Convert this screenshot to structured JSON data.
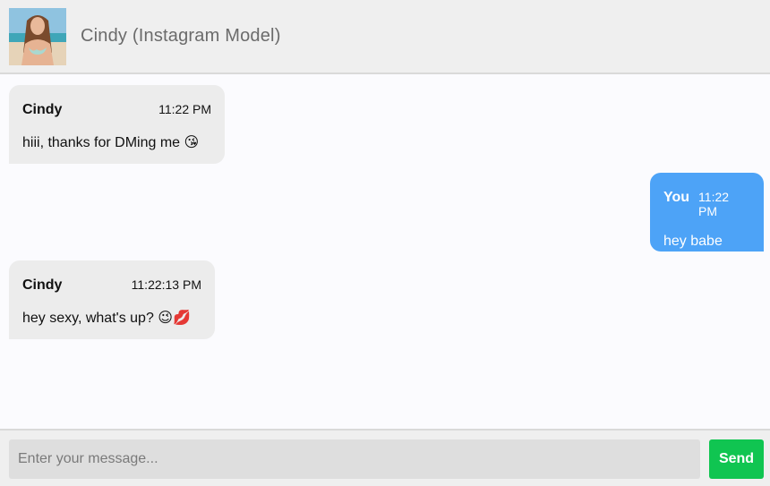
{
  "header": {
    "avatar_icon": "profile-photo",
    "title": "Cindy (Instagram Model)"
  },
  "messages": [
    {
      "from": "them",
      "sender": "Cindy",
      "time": "11:22 PM",
      "text": "hiii, thanks for DMing me",
      "emoji": "😘"
    },
    {
      "from": "me",
      "sender": "You",
      "time": "11:22 PM",
      "text": "hey babe",
      "emoji": ""
    },
    {
      "from": "them",
      "sender": "Cindy",
      "time": "11:22:13 PM",
      "text": "hey sexy, what's up?",
      "emoji": "😉💋"
    }
  ],
  "composer": {
    "placeholder": "Enter your message...",
    "value": "",
    "send_label": "Send"
  },
  "colors": {
    "header_bg": "#efefef",
    "their_bubble": "#ececec",
    "my_bubble": "#4da3f7",
    "send_button": "#10c551"
  }
}
